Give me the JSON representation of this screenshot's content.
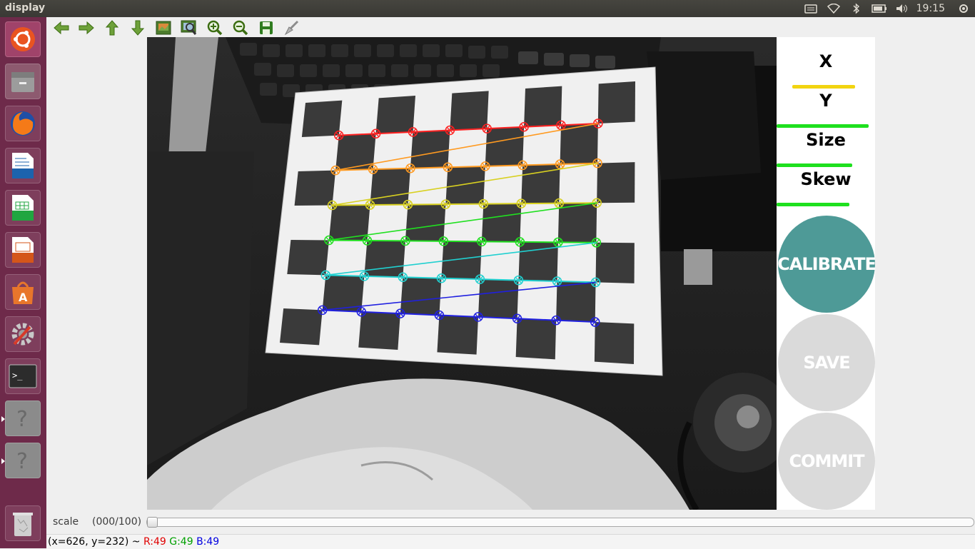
{
  "window": {
    "title": "display"
  },
  "tray": {
    "clock": "19:15"
  },
  "colors": {
    "launcher_bg": "#6e2a4a",
    "calibrate": "#4e9a97",
    "disabled_btn": "#dadada",
    "bar_yellow": "#f2d410",
    "bar_green": "#1ee01e",
    "status_r": "#e00000",
    "status_g": "#00a000",
    "status_b": "#0000e0"
  },
  "launcher": {
    "items": [
      {
        "name": "ubuntu-dash-icon"
      },
      {
        "name": "files-icon"
      },
      {
        "name": "firefox-icon"
      },
      {
        "name": "writer-icon"
      },
      {
        "name": "calc-icon"
      },
      {
        "name": "impress-icon"
      },
      {
        "name": "software-center-icon"
      },
      {
        "name": "system-settings-icon"
      },
      {
        "name": "terminal-icon"
      },
      {
        "name": "unknown-app-icon"
      },
      {
        "name": "unknown-app-icon"
      },
      {
        "name": "trash-icon"
      }
    ]
  },
  "toolbar": {
    "buttons": [
      {
        "name": "pan-left-icon"
      },
      {
        "name": "pan-right-icon"
      },
      {
        "name": "pan-up-icon"
      },
      {
        "name": "pan-down-icon"
      },
      {
        "name": "zoom-fit-icon"
      },
      {
        "name": "zoom-region-icon"
      },
      {
        "name": "zoom-in-icon"
      },
      {
        "name": "zoom-out-icon"
      },
      {
        "name": "save-image-icon"
      },
      {
        "name": "properties-icon"
      }
    ]
  },
  "panel": {
    "x_label": "X",
    "y_label": "Y",
    "size_label": "Size",
    "skew_label": "Skew",
    "x_progress": 0.65,
    "y_progress": 0.95,
    "size_progress": 0.78,
    "skew_progress": 0.75,
    "calibrate_label": "CALIBRATE",
    "save_label": "SAVE",
    "commit_label": "COMMIT"
  },
  "scale": {
    "label": "scale",
    "value": "(000/100)",
    "level": 0
  },
  "status": {
    "coords": "(x=626, y=232) ~ ",
    "r": "R:49",
    "g": "G:49",
    "b": "B:49"
  }
}
